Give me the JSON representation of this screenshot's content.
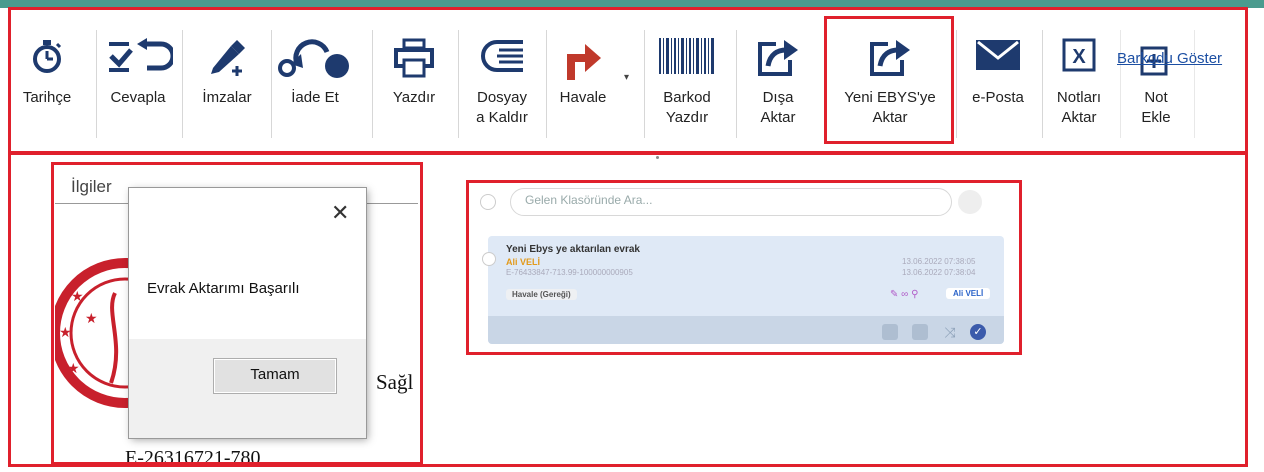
{
  "toolbar": {
    "buttons": [
      {
        "label": "Tarihçe",
        "icon": "stopwatch-icon"
      },
      {
        "label": "Cevapla",
        "icon": "reply-icon"
      },
      {
        "label": "İmzalar",
        "icon": "signature-pen-icon"
      },
      {
        "label": "İade Et",
        "icon": "return-arrow-icon"
      },
      {
        "label": "Yazdır",
        "icon": "printer-icon"
      },
      {
        "label": "Dosyay\na Kaldır",
        "icon": "file-stack-icon"
      },
      {
        "label": "Havale",
        "icon": "forward-arrow-icon"
      },
      {
        "label": "Barkod\nYazdır",
        "icon": "barcode-icon"
      },
      {
        "label": "Dışa\nAktar",
        "icon": "export-icon"
      },
      {
        "label": "Yeni EBYS'ye\nAktar",
        "icon": "export-icon"
      },
      {
        "label": "e-Posta",
        "icon": "envelope-icon"
      },
      {
        "label": "Notları\nAktar",
        "icon": "excel-icon"
      },
      {
        "label": "Not\nEkle",
        "icon": "add-note-icon"
      }
    ],
    "barkod_link": "Barkodu Göster"
  },
  "document": {
    "ilgiler": "İlgiler",
    "text_sag": "Sağl",
    "text_enum": "E-26316721-780"
  },
  "dialog": {
    "message": "Evrak Aktarımı Başarılı",
    "ok_button": "Tamam"
  },
  "inset": {
    "search_placeholder": "Gelen Klasöründe Ara...",
    "card": {
      "title": "Yeni Ebys ye aktarılan evrak",
      "sender": "Ali VELİ",
      "doc_no": "E-76433847-713.99-100000000905",
      "date1": "13.06.2022 07:38:05",
      "date2": "13.06.2022 07:38:04",
      "tag": "Havale (Gereği)",
      "user": "Ali VELİ"
    }
  },
  "colors": {
    "highlight": "#e0202c",
    "top_stripe": "#4a9b8e",
    "toolbar_icon": "#1e3a6e",
    "havale_arrow": "#c0392b"
  }
}
